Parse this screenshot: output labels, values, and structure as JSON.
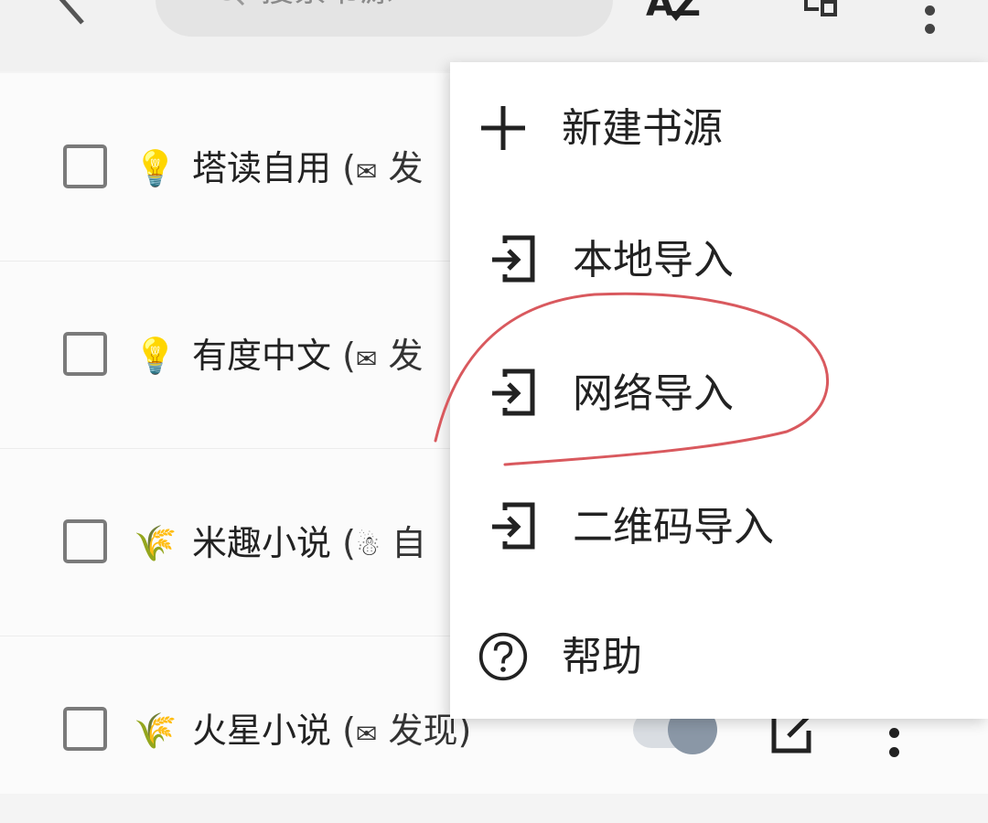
{
  "search": {
    "placeholder": "搜索书源"
  },
  "toolbar": {
    "sort_label": "AZ"
  },
  "sources": [
    {
      "emoji": "💡",
      "name": "塔读自用",
      "meta_prefix": "(",
      "meta_icon": "✉",
      "meta_text": "发"
    },
    {
      "emoji": "💡",
      "name": "有度中文",
      "meta_prefix": "(",
      "meta_icon": "✉",
      "meta_text": "发"
    },
    {
      "emoji": "🌾",
      "name": "米趣小说",
      "meta_prefix": "(",
      "meta_icon": "☃",
      "meta_text": "自"
    },
    {
      "emoji": "🌾",
      "name": "火星小说",
      "meta_prefix": "(",
      "meta_icon": "✉",
      "meta_text": "发现)"
    }
  ],
  "menu": {
    "items": [
      {
        "label": "新建书源",
        "icon": "plus-icon"
      },
      {
        "label": "本地导入",
        "icon": "import-icon"
      },
      {
        "label": "网络导入",
        "icon": "import-icon"
      },
      {
        "label": "二维码导入",
        "icon": "import-icon"
      },
      {
        "label": "帮助",
        "icon": "help-circle-icon"
      }
    ]
  },
  "colors": {
    "annotation": "#d9595e",
    "accent_toggle": "#8a97a6"
  }
}
